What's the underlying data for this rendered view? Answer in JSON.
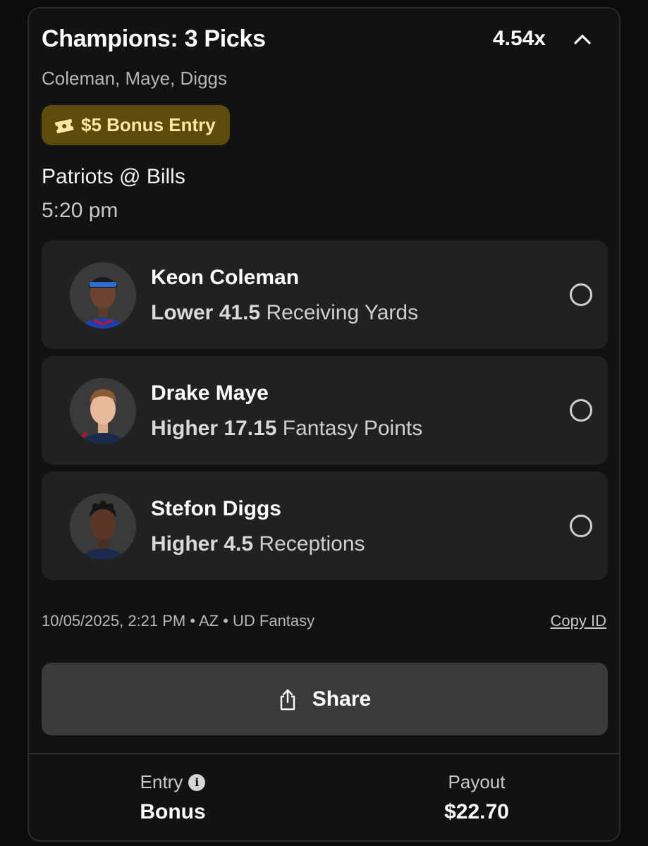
{
  "entry": {
    "title": "Champions: 3 Picks",
    "multiplier": "4.54x",
    "players_summary": "Coleman, Maye, Diggs",
    "bonus_badge": "$5 Bonus Entry",
    "game": "Patriots @ Bills",
    "game_time": "5:20 pm"
  },
  "picks": [
    {
      "player": "Keon Coleman",
      "direction": "Lower",
      "line": "41.5",
      "stat": "Receiving Yards",
      "jersey_color": "#1e3fa8",
      "accent": "#c8102e"
    },
    {
      "player": "Drake Maye",
      "direction": "Higher",
      "line": "17.15",
      "stat": "Fantasy Points",
      "jersey_color": "#1b2a4a",
      "accent": "#c8102e"
    },
    {
      "player": "Stefon Diggs",
      "direction": "Higher",
      "line": "4.5",
      "stat": "Receptions",
      "jersey_color": "#1b2a4a",
      "accent": "#c8102e"
    }
  ],
  "meta": {
    "info": "10/05/2025, 2:21 PM • AZ • UD Fantasy",
    "copy_id": "Copy ID"
  },
  "share": {
    "label": "Share"
  },
  "footer": {
    "entry_label": "Entry",
    "entry_value": "Bonus",
    "payout_label": "Payout",
    "payout_value": "$22.70"
  },
  "colors": {
    "background": "#121212",
    "card": "#212121",
    "bonus_badge_bg": "#5c4b0c",
    "bonus_badge_text": "#ffe7a3",
    "share_button": "#3a3a3a"
  },
  "icons": {
    "collapse": "chevron-up-icon",
    "bonus": "ticket-icon",
    "share": "share-icon",
    "info": "info-icon",
    "status": "pending-circle-icon"
  }
}
